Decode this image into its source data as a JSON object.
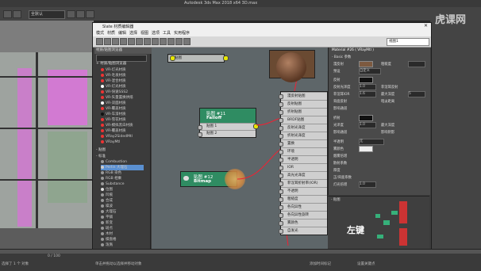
{
  "app": {
    "title": "Autodesk 3ds Max  2018 x64      3D.max",
    "workspace": "全默认",
    "watermark": "虎课网"
  },
  "slate": {
    "title": "Slate 材质编辑器",
    "menu": [
      "模式",
      "材质",
      "编辑",
      "选择",
      "视图",
      "选项",
      "工具",
      "实用程序"
    ],
    "view_dropdown": "视图1",
    "browser_title": "材质/贴图浏览器",
    "browser_section": "+ 材质/贴图浏览器",
    "browser_items": [
      "VR-灯光材质",
      "VR-毛发材质",
      "VR-混合材质",
      "VR-灯光材质",
      "VR-快速SSS2",
      "VR-矢量置换烘焙",
      "VR-双面材质",
      "VR-覆盖材质",
      "VR-车漆材质",
      "VR-雪花材质",
      "VR-模拟黑白材质",
      "VR-覆盖材质",
      "VRay2SidedMtl",
      "VRayMtl"
    ],
    "browser_section2": "- 贴图",
    "browser_section3": "- 标准",
    "map_items": [
      "Combustion",
      "Perlin 大理石",
      "RGB 染色",
      "RGB 相乘",
      "Substance",
      "位图",
      "凹痕",
      "合成",
      "噪波",
      "大理石",
      "平铺",
      "新变",
      "斑点",
      "木材",
      "棋盘格",
      "泼溅",
      "混合",
      "渐变坡度",
      "灰泥"
    ],
    "node_top_label": "贴图",
    "node_falloff": {
      "title": "贴图 #11",
      "type": "Falloff",
      "slots": [
        "贴图 1",
        "贴图 2"
      ]
    },
    "node_bitmap": {
      "title": "贴图 #12",
      "type": "Bitmap"
    },
    "material_slots": [
      "漫反射贴图",
      "反射贴图",
      "折射贴图",
      "BRDF贴图",
      "反射光泽度",
      "折射光泽度",
      "置换",
      "环境",
      "半透明",
      "IOR",
      "高光光泽度",
      "菲涅耳折射率(IOR)",
      "不透明",
      "粗糙度",
      "各向异性",
      "各向异性旋转",
      "雾颜色",
      "自发光"
    ],
    "status_left": "正在渲染",
    "status_mid": "视图导航"
  },
  "params": {
    "header": "Material #26 ( VRayMtl )",
    "group": "- Basic 参数",
    "rows": [
      "漫反射",
      "粗糙度",
      "预设",
      "反射",
      "反射光泽度",
      "菲涅耳反射",
      "菲涅耳IOR",
      "最大深度",
      "背面反射",
      "暗淡距离",
      "影响通道",
      "折射",
      "光泽度",
      "最大深度",
      "影响通道",
      "影响阴影",
      "半透明",
      "雾颜色",
      "烟雾倍增",
      "散射系数",
      "厚度",
      "正/背面系数",
      "灯光倍增"
    ],
    "preset_value": "自定义",
    "value_a": "1.0",
    "value_b": "0.0",
    "value_c": "1.6",
    "value_d": "5",
    "translucency_value": "无",
    "mapview_header": "- 贴图"
  },
  "overlay": {
    "left_key": "左键"
  },
  "status": {
    "progress": "0 / 100",
    "hint": "选择了 1 个 对象",
    "hint2": "单击并拖动以选择并移动对象",
    "add_key": "添加时间标记",
    "set_key": "设置关键点"
  }
}
